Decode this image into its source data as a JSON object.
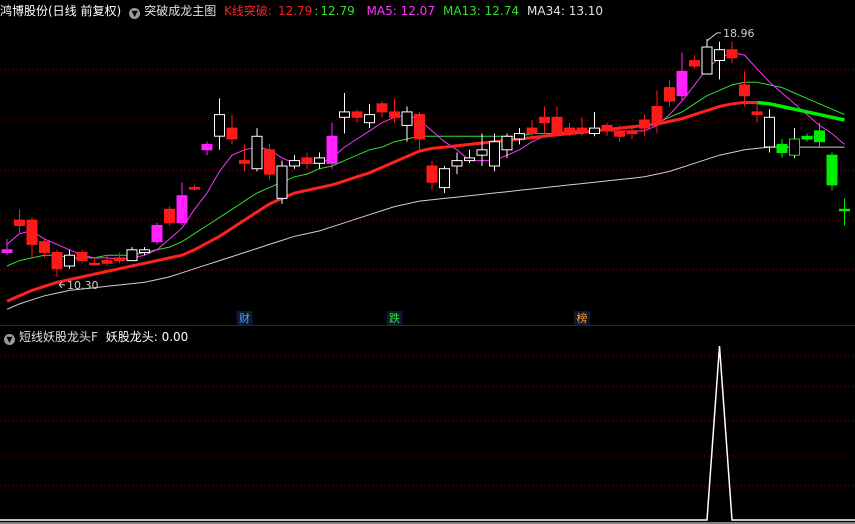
{
  "header": {
    "stock": "鸿博股份(日线 前复权)",
    "indicator": "突破成龙主图",
    "k_label": "K线突破:",
    "k_value": "12.79",
    "k_sep": ":",
    "k_value2": "12.79",
    "ma5": "MA5: 12.07",
    "ma13": "MA13: 12.74",
    "ma34": "MA34: 13.10"
  },
  "sub_header": {
    "indicator": "短线妖股龙头F",
    "value": "妖股龙头: 0.00"
  },
  "annotations": {
    "high": "18.96",
    "low": "10.30",
    "markers": [
      {
        "text": "财",
        "color": "#4aa3ff",
        "index": 19
      },
      {
        "text": "跌",
        "color": "#33dd33",
        "index": 31
      },
      {
        "text": "榜",
        "color": "#ff9933",
        "index": 46
      }
    ]
  },
  "colors": {
    "up_red": "#ff1a1a",
    "down_green": "#00ee00",
    "magenta": "#ff22ff",
    "white": "#ffffff",
    "ma5": "#ff33ff",
    "ma13": "#33dd33",
    "ma34": "#d0d0d0",
    "thick": "#ff2020",
    "grid": "#8b0000"
  },
  "chart_data": [
    {
      "type": "candlestick",
      "title": "突破成龙主图",
      "ylim": [
        9.0,
        19.8
      ],
      "ohlc": [
        [
          11.2,
          11.3,
          11.7,
          11.1,
          "m"
        ],
        [
          12.2,
          12.4,
          12.8,
          11.9,
          "r"
        ],
        [
          12.4,
          11.5,
          12.5,
          11.0,
          "r"
        ],
        [
          11.2,
          11.6,
          11.7,
          11.0,
          "r"
        ],
        [
          10.6,
          11.2,
          11.3,
          10.3,
          "r"
        ],
        [
          10.7,
          11.1,
          11.3,
          10.6,
          "w"
        ],
        [
          11.2,
          10.9,
          11.3,
          10.8,
          "r"
        ],
        [
          10.8,
          10.8,
          11.0,
          10.7,
          "r"
        ],
        [
          10.8,
          10.9,
          11.1,
          10.7,
          "r"
        ],
        [
          11.0,
          10.9,
          11.2,
          10.8,
          "r"
        ],
        [
          10.9,
          11.3,
          11.4,
          10.9,
          "w"
        ],
        [
          11.2,
          11.3,
          11.4,
          11.1,
          "w"
        ],
        [
          11.6,
          12.2,
          12.3,
          11.5,
          "m"
        ],
        [
          12.3,
          12.8,
          12.9,
          12.2,
          "r"
        ],
        [
          12.3,
          13.3,
          13.8,
          12.2,
          "m"
        ],
        [
          13.6,
          13.6,
          13.7,
          13.5,
          "r"
        ],
        [
          15.0,
          15.2,
          15.3,
          14.8,
          "m"
        ],
        [
          15.5,
          16.3,
          16.9,
          15.0,
          "w"
        ],
        [
          15.8,
          15.4,
          16.3,
          15.2,
          "r"
        ],
        [
          14.6,
          14.5,
          15.2,
          14.2,
          "r"
        ],
        [
          14.3,
          15.5,
          15.8,
          14.2,
          "w"
        ],
        [
          15.0,
          14.1,
          15.2,
          13.9,
          "r"
        ],
        [
          13.2,
          14.4,
          14.6,
          13.0,
          "w"
        ],
        [
          14.4,
          14.6,
          14.8,
          14.3,
          "w"
        ],
        [
          14.5,
          14.7,
          14.9,
          14.3,
          "r"
        ],
        [
          14.7,
          14.5,
          14.9,
          14.3,
          "w"
        ],
        [
          14.5,
          15.5,
          16.0,
          14.3,
          "m"
        ],
        [
          16.2,
          16.4,
          17.1,
          15.6,
          "w"
        ],
        [
          16.4,
          16.2,
          16.5,
          16.0,
          "r"
        ],
        [
          16.0,
          16.3,
          16.7,
          15.8,
          "w"
        ],
        [
          16.7,
          16.4,
          16.8,
          16.2,
          "r"
        ],
        [
          16.4,
          16.2,
          16.9,
          16.0,
          "r"
        ],
        [
          15.9,
          16.4,
          16.6,
          15.3,
          "w"
        ],
        [
          16.3,
          15.4,
          16.4,
          15.0,
          "r"
        ],
        [
          14.4,
          13.8,
          14.6,
          13.5,
          "r"
        ],
        [
          13.6,
          14.3,
          14.4,
          13.4,
          "w"
        ],
        [
          14.6,
          14.4,
          14.9,
          14.1,
          "w"
        ],
        [
          14.7,
          14.6,
          15.0,
          14.5,
          "w"
        ],
        [
          14.8,
          15.0,
          15.6,
          14.4,
          "w"
        ],
        [
          15.3,
          14.4,
          15.6,
          14.2,
          "w"
        ],
        [
          15.5,
          15.0,
          15.6,
          14.7,
          "w"
        ],
        [
          15.6,
          15.4,
          15.8,
          15.2,
          "w"
        ],
        [
          15.8,
          15.6,
          16.1,
          15.4,
          "r"
        ],
        [
          16.2,
          16.0,
          16.6,
          15.6,
          "r"
        ],
        [
          16.2,
          15.6,
          16.6,
          15.5,
          "r"
        ],
        [
          15.6,
          15.8,
          16.0,
          15.5,
          "r"
        ],
        [
          15.8,
          15.7,
          16.2,
          15.5,
          "r"
        ],
        [
          15.8,
          15.6,
          16.4,
          15.5,
          "w"
        ],
        [
          15.9,
          15.7,
          16.0,
          15.5,
          "r"
        ],
        [
          15.7,
          15.5,
          15.9,
          15.3,
          "r"
        ],
        [
          15.6,
          15.7,
          15.8,
          15.4,
          "r"
        ],
        [
          16.1,
          15.8,
          16.3,
          15.5,
          "r"
        ],
        [
          16.6,
          16.0,
          17.2,
          15.6,
          "r"
        ],
        [
          16.8,
          17.3,
          17.6,
          16.6,
          "r"
        ],
        [
          17.0,
          17.9,
          18.6,
          16.8,
          "m"
        ],
        [
          18.1,
          18.3,
          18.5,
          18.0,
          "r"
        ],
        [
          17.8,
          18.8,
          19.1,
          17.8,
          "w"
        ],
        [
          18.3,
          18.7,
          19.0,
          17.6,
          "w"
        ],
        [
          18.7,
          18.4,
          19.0,
          18.2,
          "r"
        ],
        [
          17.4,
          17.0,
          17.9,
          16.6,
          "r"
        ],
        [
          16.3,
          16.4,
          16.8,
          16.0,
          "r"
        ],
        [
          15.1,
          16.2,
          16.5,
          14.9,
          "w"
        ],
        [
          15.2,
          14.9,
          15.4,
          14.7,
          "g"
        ],
        [
          14.8,
          15.4,
          15.8,
          14.7,
          "wg"
        ],
        [
          15.4,
          15.5,
          15.6,
          15.3,
          "g"
        ],
        [
          15.7,
          15.3,
          16.0,
          15.1,
          "g"
        ],
        [
          14.8,
          13.7,
          14.9,
          13.5,
          "g"
        ],
        [
          12.8,
          12.8,
          13.2,
          12.2,
          "g"
        ]
      ],
      "ma5": [
        11.5,
        11.9,
        12.0,
        11.7,
        11.5,
        11.3,
        11.1,
        11.0,
        11.0,
        10.95,
        11.0,
        11.1,
        11.3,
        11.7,
        12.1,
        12.8,
        13.4,
        14.2,
        14.8,
        15.0,
        15.1,
        15.0,
        14.7,
        14.5,
        14.5,
        14.5,
        14.7,
        15.1,
        15.4,
        15.7,
        16.0,
        16.2,
        16.3,
        16.1,
        15.7,
        15.3,
        15.0,
        14.6,
        14.6,
        14.6,
        14.8,
        15.0,
        15.3,
        15.5,
        15.6,
        15.7,
        15.7,
        15.7,
        15.7,
        15.7,
        15.7,
        15.7,
        15.9,
        16.3,
        16.8,
        17.4,
        18.0,
        18.4,
        18.6,
        18.5,
        18.0,
        17.5,
        17.1,
        16.7,
        16.3,
        15.9,
        15.6,
        15.2
      ],
      "ma13": [
        10.7,
        10.9,
        11.0,
        11.1,
        11.1,
        11.0,
        11.0,
        11.0,
        11.1,
        11.1,
        11.1,
        11.2,
        11.3,
        11.4,
        11.6,
        11.9,
        12.2,
        12.5,
        12.8,
        13.1,
        13.4,
        13.6,
        13.8,
        14.0,
        14.1,
        14.3,
        14.4,
        14.6,
        14.8,
        15.0,
        15.1,
        15.3,
        15.4,
        15.5,
        15.5,
        15.5,
        15.5,
        15.5,
        15.5,
        15.5,
        15.5,
        15.5,
        15.6,
        15.6,
        15.6,
        15.6,
        15.6,
        15.7,
        15.7,
        15.8,
        15.8,
        15.9,
        16.0,
        16.2,
        16.4,
        16.7,
        17.0,
        17.2,
        17.4,
        17.5,
        17.5,
        17.4,
        17.3,
        17.1,
        16.9,
        16.7,
        16.5,
        16.3
      ],
      "ma34": [
        9.1,
        9.3,
        9.45,
        9.6,
        9.7,
        9.8,
        9.85,
        9.9,
        9.95,
        10.0,
        10.05,
        10.1,
        10.2,
        10.3,
        10.45,
        10.6,
        10.75,
        10.9,
        11.05,
        11.2,
        11.35,
        11.5,
        11.65,
        11.8,
        11.9,
        12.0,
        12.15,
        12.3,
        12.45,
        12.6,
        12.75,
        12.9,
        13.0,
        13.1,
        13.15,
        13.2,
        13.25,
        13.3,
        13.35,
        13.4,
        13.45,
        13.5,
        13.55,
        13.6,
        13.65,
        13.7,
        13.75,
        13.8,
        13.85,
        13.9,
        13.95,
        14.0,
        14.1,
        14.2,
        14.35,
        14.5,
        14.65,
        14.8,
        14.9,
        15.0,
        15.05,
        15.1,
        15.1,
        15.1,
        15.1,
        15.1,
        15.1,
        15.1
      ],
      "thick": [
        9.4,
        9.6,
        9.8,
        9.95,
        10.1,
        10.2,
        10.3,
        10.4,
        10.5,
        10.6,
        10.7,
        10.8,
        10.9,
        11.0,
        11.1,
        11.3,
        11.55,
        11.8,
        12.1,
        12.4,
        12.7,
        13.0,
        13.2,
        13.4,
        13.5,
        13.6,
        13.7,
        13.85,
        14.0,
        14.15,
        14.35,
        14.55,
        14.75,
        14.95,
        15.05,
        15.1,
        15.15,
        15.2,
        15.25,
        15.3,
        15.35,
        15.4,
        15.45,
        15.5,
        15.55,
        15.6,
        15.65,
        15.7,
        15.75,
        15.8,
        15.85,
        15.9,
        15.95,
        16.05,
        16.15,
        16.3,
        16.45,
        16.6,
        16.7,
        16.75,
        16.75,
        16.7,
        16.6,
        16.5,
        16.4,
        16.3,
        16.2,
        16.1
      ]
    },
    {
      "type": "line",
      "title": "短线妖股龙头F",
      "series": [
        {
          "name": "妖股龙头",
          "values": [
            0,
            0,
            0,
            0,
            0,
            0,
            0,
            0,
            0,
            0,
            0,
            0,
            0,
            0,
            0,
            0,
            0,
            0,
            0,
            0,
            0,
            0,
            0,
            0,
            0,
            0,
            0,
            0,
            0,
            0,
            0,
            0,
            0,
            0,
            0,
            0,
            0,
            0,
            0,
            0,
            0,
            0,
            0,
            0,
            0,
            0,
            0,
            0,
            0,
            0,
            0,
            0,
            0,
            0,
            0,
            0,
            0,
            1,
            0,
            0,
            0,
            0,
            0,
            0,
            0,
            0,
            0,
            0
          ]
        }
      ],
      "ylim": [
        0,
        1
      ]
    }
  ]
}
